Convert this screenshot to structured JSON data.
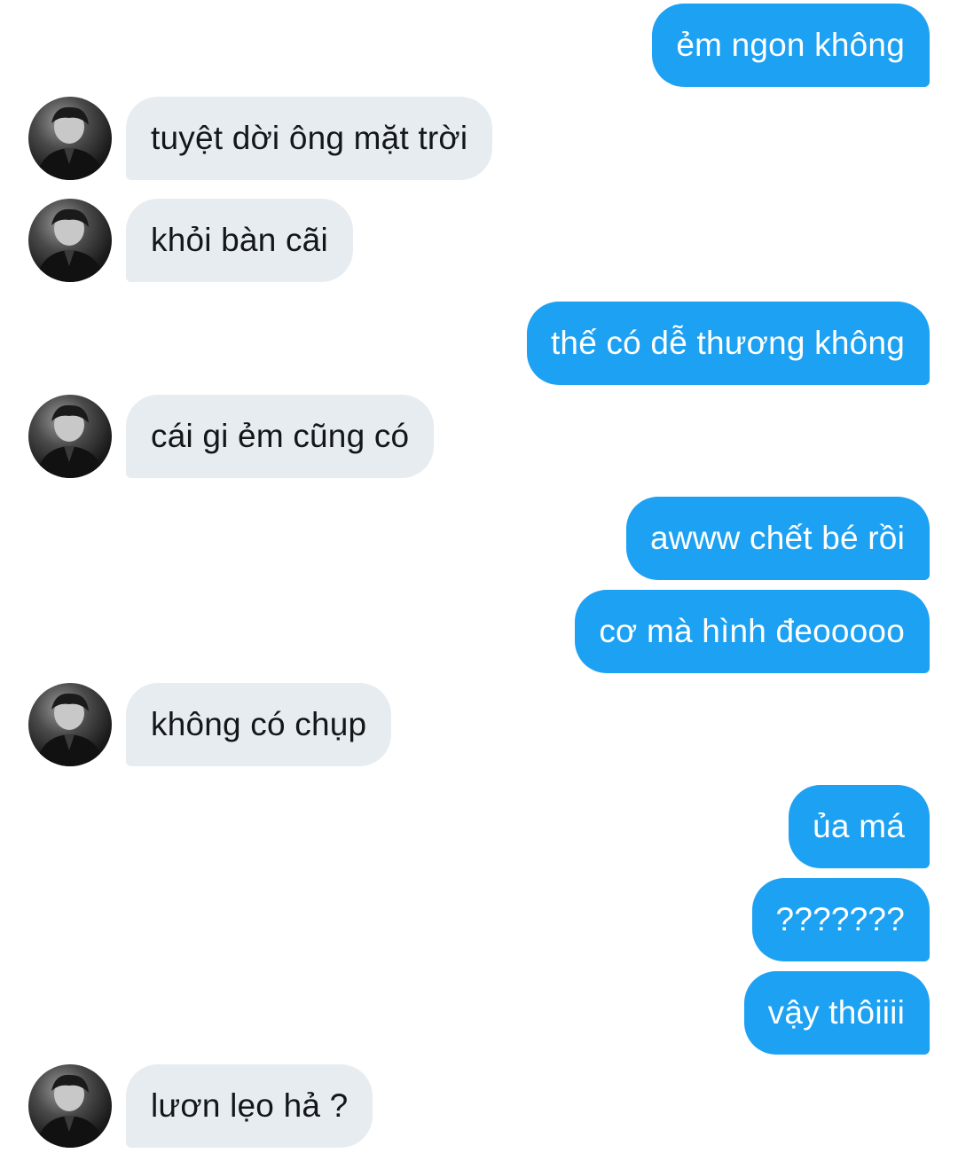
{
  "conversation": {
    "messages": [
      {
        "direction": "outgoing",
        "text": "ẻm ngon không"
      },
      {
        "direction": "incoming",
        "text": "tuyệt dời ông mặt trời"
      },
      {
        "direction": "incoming",
        "text": "khỏi bàn cãi"
      },
      {
        "direction": "outgoing",
        "text": "thế có dễ thương không"
      },
      {
        "direction": "incoming",
        "text": "cái gi ẻm cũng có"
      },
      {
        "direction": "outgoing",
        "text": "awww chết bé rồi"
      },
      {
        "direction": "outgoing",
        "text": "cơ mà hình đeooooo"
      },
      {
        "direction": "incoming",
        "text": "không có chụp"
      },
      {
        "direction": "outgoing",
        "text": "ủa má"
      },
      {
        "direction": "outgoing",
        "text": "???????"
      },
      {
        "direction": "outgoing",
        "text": "vậy thôiiii"
      },
      {
        "direction": "incoming",
        "text": "lươn lẹo hả ?"
      }
    ]
  },
  "colors": {
    "outgoing_bubble": "#1da1f2",
    "incoming_bubble": "#e6ecf0",
    "outgoing_text": "#ffffff",
    "incoming_text": "#14171a"
  },
  "icons": {
    "avatar": "contact-avatar-photo"
  }
}
